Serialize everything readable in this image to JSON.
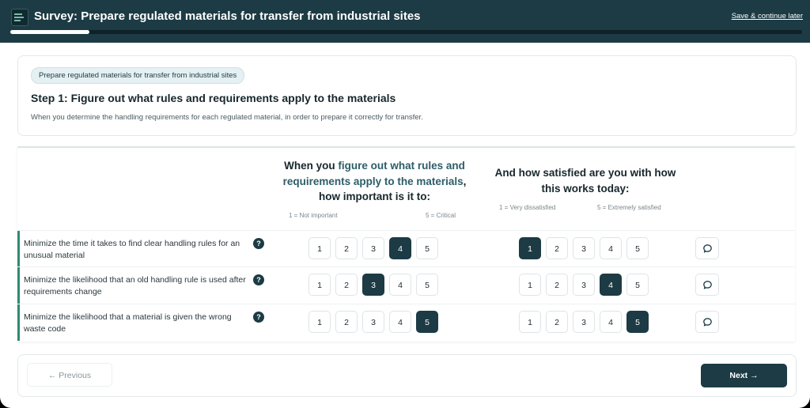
{
  "header": {
    "title": "Survey: Prepare regulated materials for transfer from industrial sites",
    "save_link": "Save & continue later",
    "progress": 0.1
  },
  "step": {
    "badge": "Prepare regulated materials for transfer from industrial sites",
    "title": "Step 1: Figure out what rules and requirements apply to the materials",
    "description": "When you determine the handling requirements for each regulated material, in order to prepare it correctly for transfer."
  },
  "matrix": {
    "importance": {
      "heading_prefix": "When you ",
      "heading_highlight": "figure out what rules and requirements apply to the materials",
      "heading_suffix": ", how important is it to:",
      "scale_low": "1 = Not important",
      "scale_high": "5 = Critical"
    },
    "satisfaction": {
      "heading": "And how satisfied are you with how this works today:",
      "scale_low": "1 = Very dissatisfied",
      "scale_high": "5 = Extremely satisfied"
    },
    "options": [
      "1",
      "2",
      "3",
      "4",
      "5"
    ],
    "help_symbol": "?",
    "rows": [
      {
        "label": "Minimize the time it takes to find clear handling rules for an unusual material",
        "importance": 4,
        "satisfaction": 1
      },
      {
        "label": "Minimize the likelihood that an old handling rule is used after requirements change",
        "importance": 3,
        "satisfaction": 4
      },
      {
        "label": "Minimize the likelihood that a material is given the wrong waste code",
        "importance": 5,
        "satisfaction": 5
      }
    ]
  },
  "footer": {
    "previous": "← Previous",
    "next": "Next →"
  },
  "colors": {
    "header_bg": "#1c3b44",
    "accent": "#2f8a72",
    "selected": "#1c3b44"
  }
}
